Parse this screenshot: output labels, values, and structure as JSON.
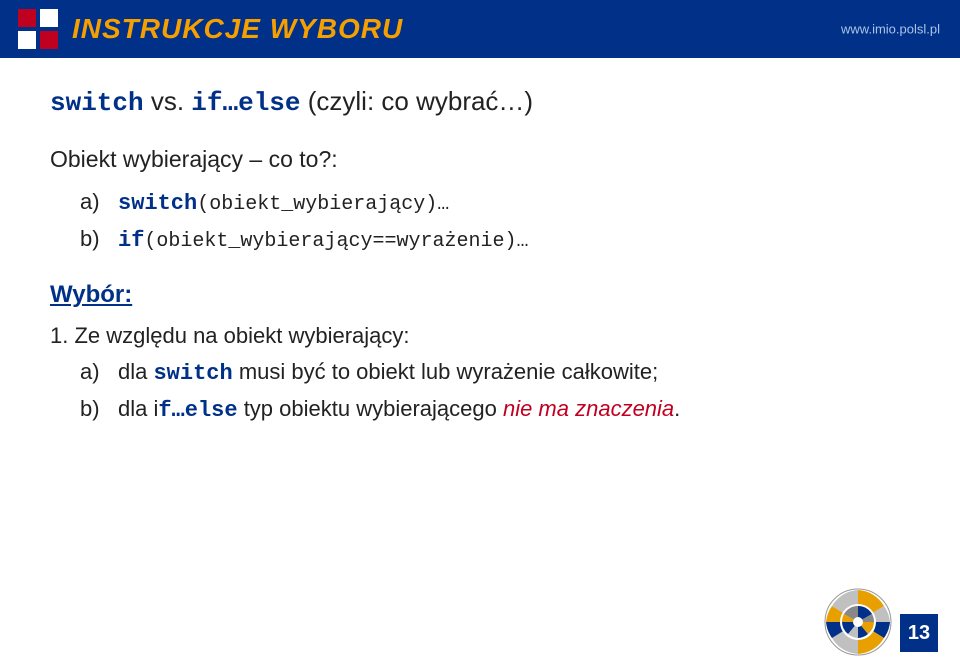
{
  "header": {
    "title": "INSTRUKCJE WYBORU",
    "website": "www.imio.polsl.pl",
    "slide_number": "13"
  },
  "content": {
    "line1_parts": {
      "kw1": "switch",
      "vs": " vs. ",
      "kw2": "if…else",
      "rest": " (czyli: co wybrać…)"
    },
    "obiekt_label": "Obiekt wybierający – co to?:",
    "list_a_prefix": "a)",
    "list_a_code": "switch",
    "list_a_rest": "(obiekt_wybierający)…",
    "list_b_prefix": "b)",
    "list_b_code": "if",
    "list_b_rest": "(obiekt_wybierający==wyrażenie)…",
    "wybor_heading": "Wybór:",
    "point1": "1. Ze względu na obiekt wybierający:",
    "bottom_a_prefix": "a)",
    "bottom_a_text1": "dla ",
    "bottom_a_kw": "switch",
    "bottom_a_text2": " musi być to obiekt lub wyrażenie całkowite;",
    "bottom_b_prefix": "b)",
    "bottom_b_text1": "dla i",
    "bottom_b_kw": "f…else",
    "bottom_b_text2": " typ obiektu wybierającego ",
    "bottom_b_highlight": "nie ma znaczenia",
    "bottom_b_end": "."
  }
}
